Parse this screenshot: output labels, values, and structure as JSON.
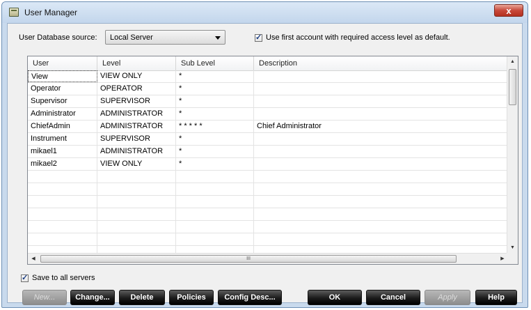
{
  "window": {
    "title": "User Manager",
    "close_glyph": "x"
  },
  "source": {
    "label": "User Database source:",
    "selected": "Local Server"
  },
  "default_account": {
    "label": "Use first account with required access level as default.",
    "checked": true
  },
  "table": {
    "columns": [
      "User",
      "Level",
      "Sub Level",
      "Description"
    ],
    "rows": [
      {
        "user": "View",
        "level": "VIEW ONLY",
        "sublevel": "*",
        "description": ""
      },
      {
        "user": "Operator",
        "level": "OPERATOR",
        "sublevel": "*",
        "description": ""
      },
      {
        "user": "Supervisor",
        "level": "SUPERVISOR",
        "sublevel": "*",
        "description": ""
      },
      {
        "user": "Administrator",
        "level": "ADMINISTRATOR",
        "sublevel": "*",
        "description": ""
      },
      {
        "user": "ChiefAdmin",
        "level": "ADMINISTRATOR",
        "sublevel": "* * * * *",
        "description": "Chief Administrator"
      },
      {
        "user": "Instrument",
        "level": "SUPERVISOR",
        "sublevel": "*",
        "description": ""
      },
      {
        "user": "mikael1",
        "level": "ADMINISTRATOR",
        "sublevel": "*",
        "description": ""
      },
      {
        "user": "mikael2",
        "level": "VIEW ONLY",
        "sublevel": "*",
        "description": ""
      }
    ],
    "empty_rows": 8,
    "selected_row": 0,
    "hscroll_grip": "III"
  },
  "save_all": {
    "label": "Save to all servers",
    "checked": true
  },
  "buttons": {
    "new": "New...",
    "change": "Change...",
    "delete": "Delete",
    "policies": "Policies",
    "config_desc": "Config Desc...",
    "ok": "OK",
    "cancel": "Cancel",
    "apply": "Apply",
    "help": "Help"
  }
}
